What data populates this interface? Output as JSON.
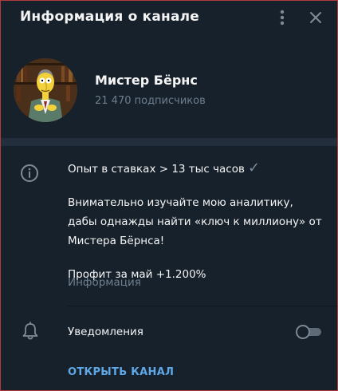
{
  "header": {
    "title": "Информация о канале",
    "more_icon": "more-vertical-icon",
    "close_icon": "close-icon"
  },
  "channel": {
    "name": "Мистер Бёрнс",
    "subscribers": "21 470 подписчиков",
    "avatar_icon": "channel-avatar"
  },
  "description": {
    "line1": "Опыт в ставках > 13 тыс часов",
    "line1_icon": "checkmark-icon",
    "paragraph2_line1": "Внимательно изучайте мою аналитику,",
    "paragraph2_line2": "дабы однажды найти «ключ к миллиону» от",
    "paragraph2_line3": "Мистера Бёрнса!",
    "line3": "Профит за май +1.200%",
    "label": "Информация",
    "info_icon": "info-icon"
  },
  "notifications": {
    "label": "Уведомления",
    "enabled": false,
    "bell_icon": "bell-icon"
  },
  "actions": {
    "open_channel": "ОТКРЫТЬ КАНАЛ"
  },
  "colors": {
    "background": "#17212b",
    "separator": "#232e3c",
    "text_primary": "#f5f5f5",
    "text_secondary": "#6d7f8f",
    "accent": "#5fa8e8",
    "border": "#b23a3a"
  }
}
